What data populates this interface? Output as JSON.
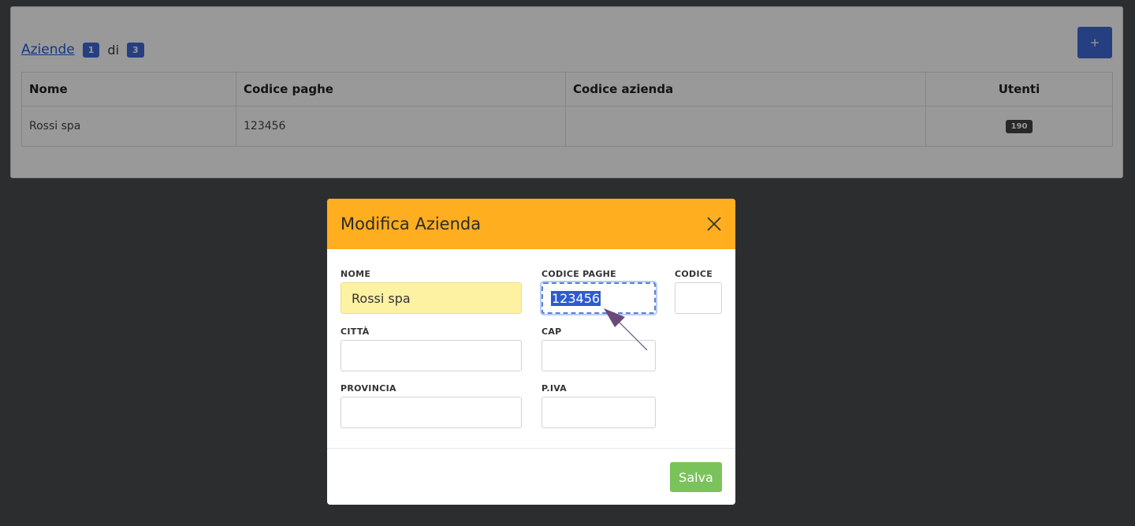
{
  "header": {
    "link": "Aziende",
    "current_page": "1",
    "of": "di",
    "total_pages": "3",
    "add_label": "+"
  },
  "table": {
    "columns": [
      "Nome",
      "Codice paghe",
      "Codice azienda",
      "Utenti"
    ],
    "rows": [
      {
        "nome": "Rossi spa",
        "codice_paghe": "123456",
        "codice_azienda": "",
        "utenti": "190"
      }
    ]
  },
  "modal": {
    "title": "Modifica Azienda",
    "fields": {
      "nome": {
        "label": "NOME",
        "value": "Rossi spa"
      },
      "codice_paghe": {
        "label": "CODICE PAGHE",
        "value": "123456"
      },
      "codice": {
        "label": "CODICE",
        "value": ""
      },
      "citta": {
        "label": "CITTÀ",
        "value": ""
      },
      "cap": {
        "label": "CAP",
        "value": ""
      },
      "provincia": {
        "label": "PROVINCIA",
        "value": ""
      },
      "piva": {
        "label": "P.IVA",
        "value": ""
      }
    },
    "save_label": "Salva"
  },
  "colors": {
    "modal_header": "#ffae20",
    "primary": "#3f6ad8",
    "success": "#7ac35a",
    "annotation_arrow": "#6b4a7a"
  }
}
